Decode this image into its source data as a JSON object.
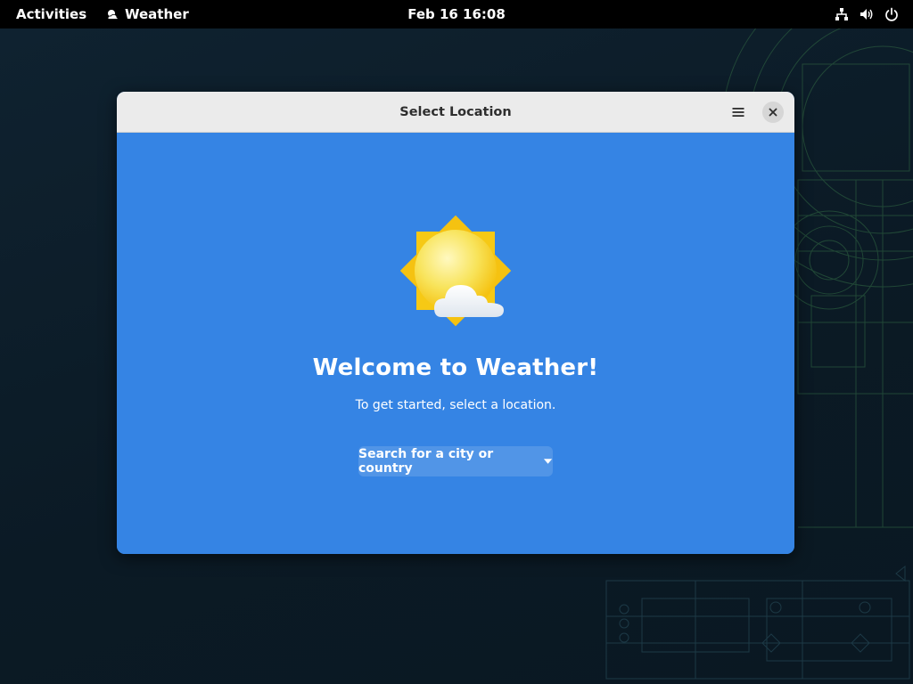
{
  "topbar": {
    "activities_label": "Activities",
    "app_name": "Weather",
    "app_icon": "weather-app-icon",
    "clock": "Feb 16  16:08",
    "tray_icons": [
      "network-icon",
      "volume-icon",
      "power-icon"
    ]
  },
  "window": {
    "title": "Select Location",
    "menu_icon": "hamburger-menu-icon",
    "close_icon": "close-icon",
    "illustration": "sun-cloud-icon",
    "welcome_title": "Welcome to Weather!",
    "welcome_subtitle": "To get started, select a location.",
    "search_label": "Search for a city or country",
    "search_icon": "chevron-down-icon"
  },
  "colors": {
    "accent": "#3584e4",
    "headerbar": "#ebebeb",
    "topbar": "#000000",
    "desktop": "#0e1d29"
  }
}
